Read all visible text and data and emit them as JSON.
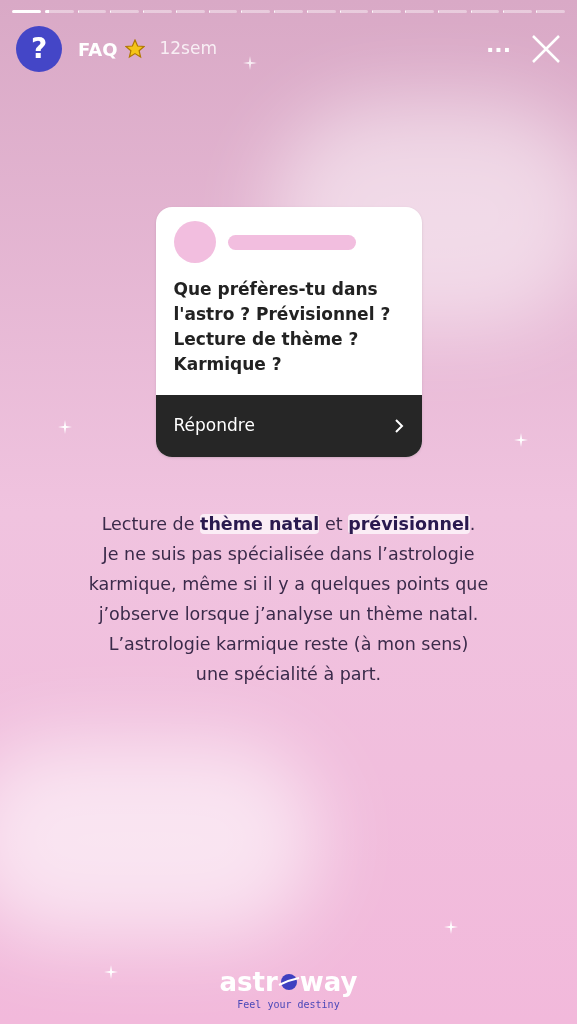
{
  "progress": [
    {
      "level": 1
    },
    {
      "level": 0.15
    },
    {
      "level": 0
    },
    {
      "level": 0
    },
    {
      "level": 0
    },
    {
      "level": 0
    },
    {
      "level": 0
    },
    {
      "level": 0
    },
    {
      "level": 0
    },
    {
      "level": 0
    },
    {
      "level": 0
    },
    {
      "level": 0
    },
    {
      "level": 0
    },
    {
      "level": 0
    },
    {
      "level": 0
    },
    {
      "level": 0
    },
    {
      "level": 0
    }
  ],
  "header": {
    "avatar_glyph": "?",
    "title": "FAQ",
    "time": "12sem",
    "more": "···"
  },
  "question_card": {
    "question": "Que préfères-tu dans l'astro ? Prévisionnel ? Lecture de thème ? Karmique ?",
    "action": "Répondre"
  },
  "answer": {
    "lines": [
      "Lecture de **thème natal** et **prévisionnel**.",
      "Je ne suis pas spécialisée dans l’astrologie",
      "karmique, même si il y a quelques points que",
      "j’observe lorsque j’analyse un thème natal.",
      "L’astrologie karmique reste (à mon sens)",
      "une spécialité à part."
    ]
  },
  "logo": {
    "before": "astr",
    "after": "way",
    "tagline": "Feel your destiny"
  }
}
